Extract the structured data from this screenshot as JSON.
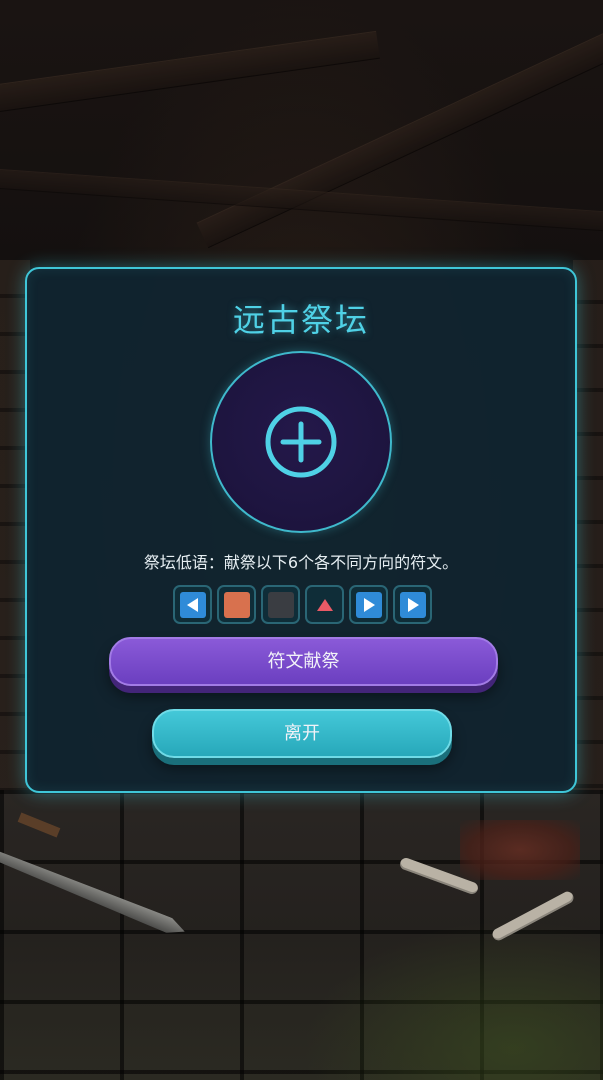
{
  "altar": {
    "title": "远古祭坛",
    "hint": "祭坛低语：献祭以下6个各不同方向的符文。",
    "add_slot_icon": "plus-circle-icon",
    "runes": [
      {
        "icon": "arrow-left-icon",
        "color": "#2f8bd8"
      },
      {
        "icon": "orange-square-icon",
        "color": "#d8714e"
      },
      {
        "icon": "gray-square-icon",
        "color": "#3a3d42"
      },
      {
        "icon": "triangle-up-icon",
        "color": "#e85a66"
      },
      {
        "icon": "arrow-right-icon",
        "color": "#2f8bd8"
      },
      {
        "icon": "arrow-right-icon",
        "color": "#2f8bd8"
      }
    ],
    "sacrifice_label": "符文献祭",
    "leave_label": "离开"
  },
  "colors": {
    "accent": "#3fc6d8",
    "button_purple": "#7a4dd0",
    "button_cyan": "#36b8c9"
  }
}
